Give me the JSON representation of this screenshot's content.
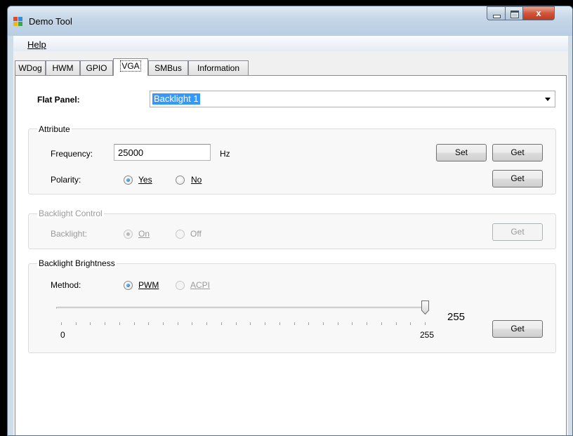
{
  "window": {
    "title": "Demo Tool",
    "close_glyph": "x"
  },
  "menu": {
    "help_label": "Help"
  },
  "tabs": [
    {
      "label": "WDog"
    },
    {
      "label": "HWM"
    },
    {
      "label": "GPIO"
    },
    {
      "label": "VGA",
      "active": true
    },
    {
      "label": "SMBus"
    },
    {
      "label": "Information"
    }
  ],
  "flat_panel": {
    "label": "Flat Panel:",
    "selected": "Backlight 1"
  },
  "attribute": {
    "title": "Attribute",
    "frequency_label": "Frequency:",
    "frequency_value": "25000",
    "frequency_unit": "Hz",
    "set_label": "Set",
    "get_label": "Get",
    "polarity_label": "Polarity:",
    "polarity_yes": "Yes",
    "polarity_no": "No",
    "polarity_selected": "Yes",
    "polarity_get_label": "Get"
  },
  "backlight_control": {
    "title": "Backlight Control",
    "backlight_label": "Backlight:",
    "on_label": "On",
    "off_label": "Off",
    "selected": "On",
    "get_label": "Get",
    "enabled": false
  },
  "backlight_brightness": {
    "title": "Backlight Brightness",
    "method_label": "Method:",
    "pwm_label": "PWM",
    "acpi_label": "ACPI",
    "method_selected": "PWM",
    "slider_min_label": "0",
    "slider_max_label": "255",
    "slider_value": 255,
    "slider_min": 0,
    "slider_max": 255,
    "value_display": "255",
    "get_label": "Get"
  },
  "colors": {
    "selection": "#3399ff",
    "close_button": "#d0553a",
    "titlebar": "#c4d6e7"
  }
}
